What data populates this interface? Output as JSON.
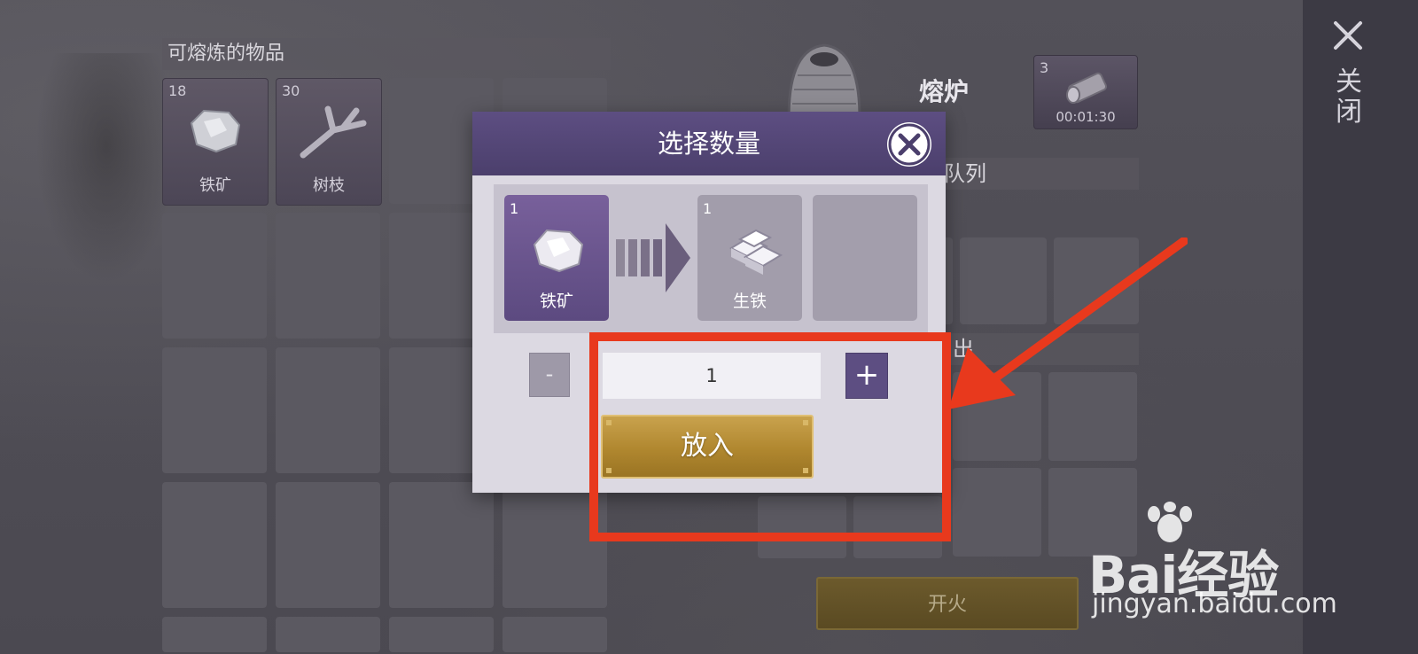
{
  "smeltable": {
    "title": "可熔炼的物品",
    "items": [
      {
        "count": "18",
        "name": "铁矿",
        "icon": "iron-ore-icon"
      },
      {
        "count": "30",
        "name": "树枝",
        "icon": "branch-icon"
      }
    ]
  },
  "furnace": {
    "title": "熔炉",
    "icon": "furnace-icon",
    "fuel": {
      "count": "3",
      "timer": "00:01:30",
      "icon": "log-icon"
    },
    "queue_label": "队列",
    "output_label": "出",
    "fire_button_label": "开火"
  },
  "side_panel": {
    "close_label": "关闭",
    "icon": "close-icon"
  },
  "modal": {
    "title": "选择数量",
    "close_icon": "close-icon",
    "input_item": {
      "count": "1",
      "name": "铁矿",
      "icon": "iron-ore-icon"
    },
    "output_item": {
      "count": "1",
      "name": "生铁",
      "icon": "pig-iron-icon"
    },
    "minus_label": "-",
    "quantity_value": "1",
    "plus_label": "+",
    "confirm_label": "放入"
  },
  "annotation": {
    "color": "#e8391d"
  },
  "watermark": {
    "brand": "Bai经验",
    "url": "jingyan.baidu.com"
  },
  "colors": {
    "modal_header": "#5d4e82",
    "confirm_button": "#b0872f",
    "background": "#4d4b52"
  }
}
